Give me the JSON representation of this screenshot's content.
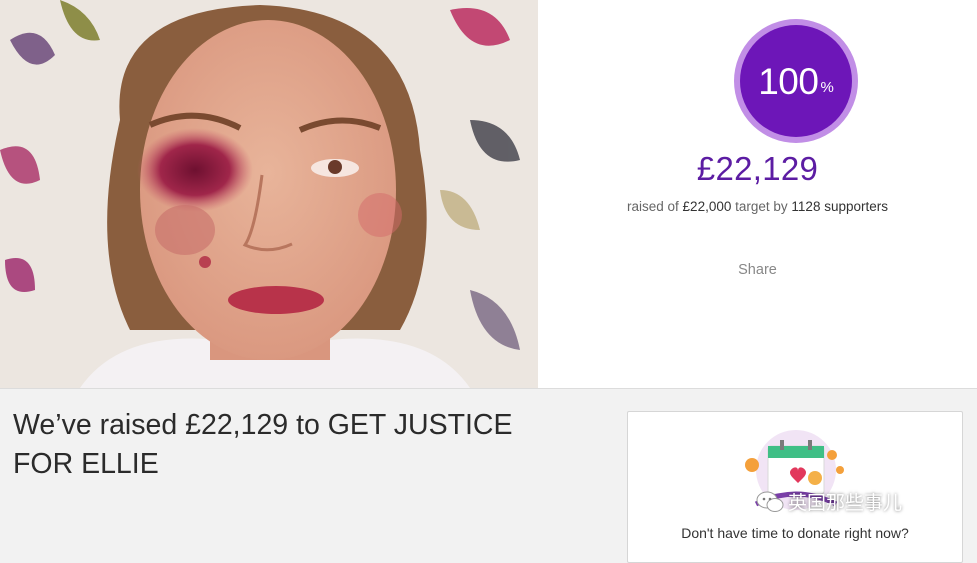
{
  "campaign": {
    "image_alt": "Campaign photo",
    "percent": "100",
    "percent_sign": "%",
    "percent_value": 100,
    "amount_raised": "£22,129",
    "raised_prefix": "raised of",
    "target_amount": "£22,000",
    "target_word": "target by",
    "supporters": "1128 supporters",
    "share_label": "Share",
    "headline": "We’ve raised £22,129 to GET JUSTICE FOR ELLIE"
  },
  "sidebar_card": {
    "text": "Don't have time to donate right now?",
    "icon": "calendar-icon"
  },
  "watermark": {
    "text": "英国那些事儿",
    "icon": "wechat-icon"
  },
  "colors": {
    "accent": "#6d16b8",
    "ring": "#c18ee6",
    "amount": "#5c1ca3"
  }
}
